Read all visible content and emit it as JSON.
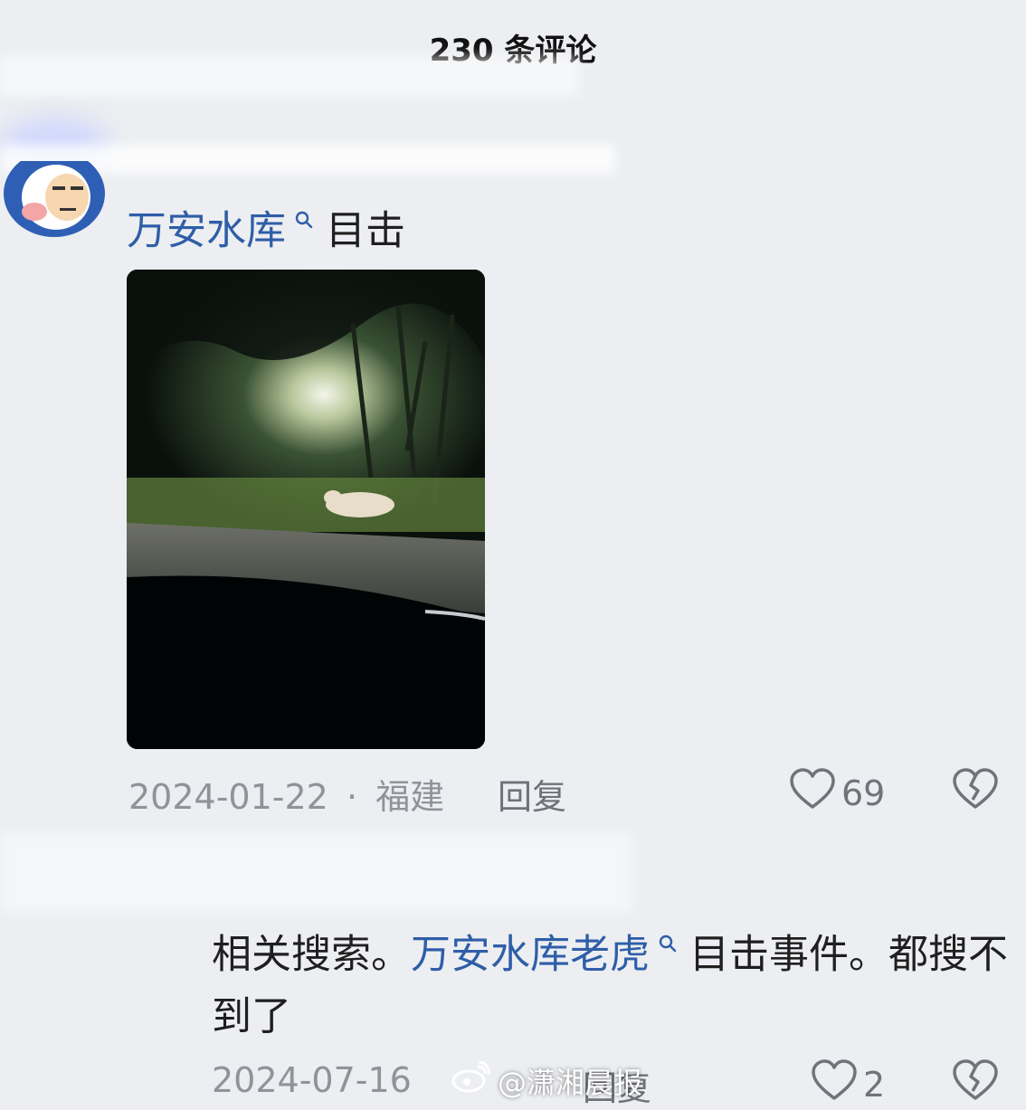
{
  "header": {
    "title": "230 条评论"
  },
  "comment1": {
    "hashtag": "万安水库",
    "text": "目击",
    "meta": {
      "date": "2024-01-22",
      "separator": "·",
      "location": "福建"
    },
    "reply_label": "回复",
    "likes": "69"
  },
  "comment2": {
    "prefix": "相关搜索。",
    "hashtag": "万安水库老虎",
    "suffix": "目击事件。都搜不到了",
    "meta": {
      "date": "2024-07-16"
    },
    "reply_label": "回复",
    "likes": "2"
  },
  "watermark": {
    "text": "@潇湘晨报"
  },
  "icons": {
    "search": "search-icon",
    "like": "heart-icon",
    "dislike": "broken-heart-icon",
    "weibo": "weibo-logo-icon"
  },
  "colors": {
    "hashtag": "#2f5ea8",
    "meta": "#8f939a"
  }
}
